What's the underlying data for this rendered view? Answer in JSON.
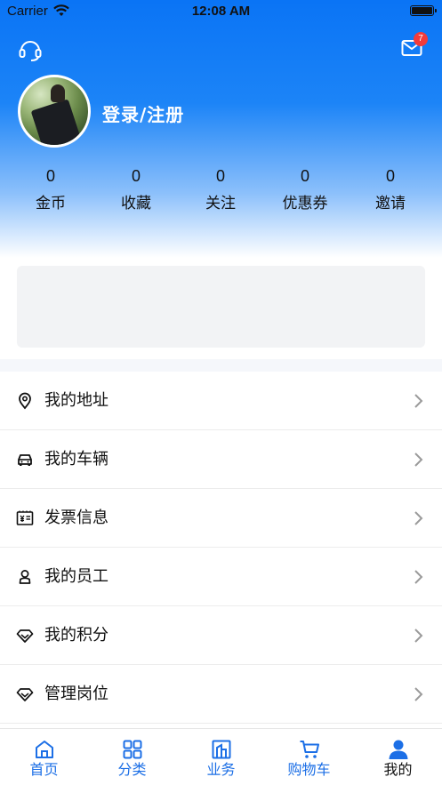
{
  "status_bar": {
    "carrier": "Carrier",
    "time": "12:08 AM"
  },
  "header": {
    "login_label": "登录/注册",
    "mail_badge_count": "7",
    "icons": {
      "support": "headset-icon",
      "mail": "mail-icon"
    }
  },
  "stats": [
    {
      "value": "0",
      "label": "金币"
    },
    {
      "value": "0",
      "label": "收藏"
    },
    {
      "value": "0",
      "label": "关注"
    },
    {
      "value": "0",
      "label": "优惠券"
    },
    {
      "value": "0",
      "label": "邀请"
    }
  ],
  "menu": [
    {
      "label": "我的地址",
      "icon": "location-pin-icon"
    },
    {
      "label": "我的车辆",
      "icon": "car-icon"
    },
    {
      "label": "发票信息",
      "icon": "invoice-icon"
    },
    {
      "label": "我的员工",
      "icon": "employee-icon"
    },
    {
      "label": "我的积分",
      "icon": "diamond-icon"
    },
    {
      "label": "管理岗位",
      "icon": "diamond-icon"
    }
  ],
  "tabbar": [
    {
      "label": "首页",
      "icon": "home-icon"
    },
    {
      "label": "分类",
      "icon": "grid-icon"
    },
    {
      "label": "业务",
      "icon": "building-icon"
    },
    {
      "label": "购物车",
      "icon": "cart-icon"
    },
    {
      "label": "我的",
      "icon": "user-icon",
      "active": true
    }
  ],
  "colors": {
    "brand_blue": "#0a74f5",
    "tab_blue": "#1c6fe6",
    "badge_red": "#f23b3b"
  }
}
